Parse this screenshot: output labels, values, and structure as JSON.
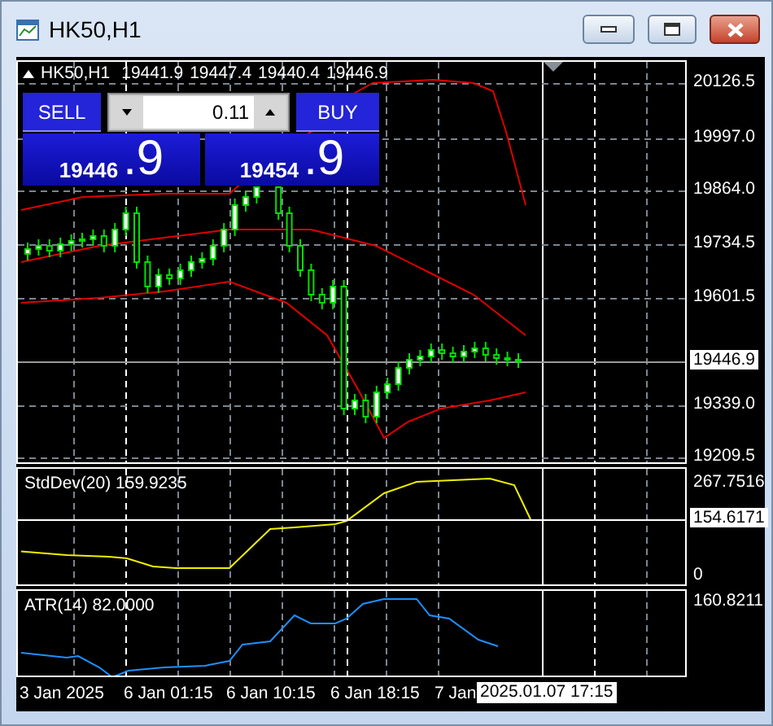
{
  "window": {
    "title": "HK50,H1"
  },
  "chart": {
    "symbol": "HK50,H1",
    "ohlc": [
      "19441.9",
      "19447.4",
      "19440.4",
      "19446.9"
    ],
    "one_click": {
      "sell_label": "SELL",
      "buy_label": "BUY",
      "lot": "0.11",
      "bid": "19446",
      "bid_fraction": ".9",
      "ask": "19454",
      "ask_fraction": ".9"
    },
    "price_axis": [
      "20126.5",
      "19997.0",
      "19864.0",
      "19734.5",
      "19601.5",
      "19339.0",
      "19209.5"
    ],
    "current_price": "19446.9",
    "indicators": [
      {
        "label": "StdDev(20) 159.9235",
        "axis": [
          "267.7516",
          "0"
        ],
        "cursor_value": "154.6171"
      },
      {
        "label": "ATR(14) 82.0000",
        "axis": [
          "160.8211"
        ]
      }
    ],
    "time_axis": [
      "3 Jan 2025",
      "6 Jan 01:15",
      "6 Jan 10:15",
      "6 Jan 18:15",
      "7 Jan"
    ],
    "cursor_time": "2025.01.07 17:15"
  }
}
